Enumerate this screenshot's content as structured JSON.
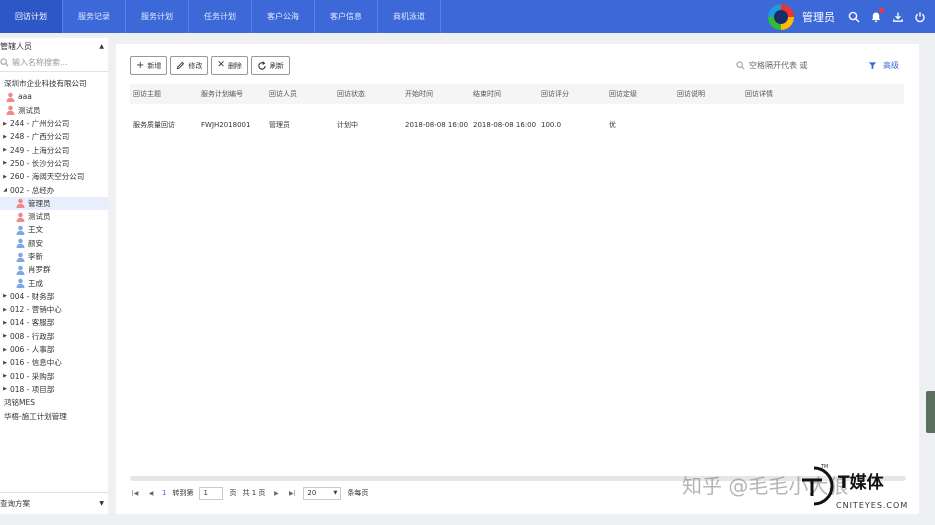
{
  "nav": {
    "tabs": [
      {
        "label": "回访计划",
        "active": true
      },
      {
        "label": "服务记录"
      },
      {
        "label": "服务计划"
      },
      {
        "label": "任务计划"
      },
      {
        "label": "客户公海"
      },
      {
        "label": "客户信息"
      },
      {
        "label": "商机泳道"
      }
    ],
    "user_name": "管理员",
    "accent": "#3d68d8"
  },
  "sidebar": {
    "title": "管辖人员",
    "search_placeholder": "输入名称搜索...",
    "tree": [
      {
        "label": "深圳市企业科技有限公司",
        "level": 0,
        "type": "org"
      },
      {
        "label": "aaa",
        "level": 1,
        "type": "user-red"
      },
      {
        "label": "测试员",
        "level": 1,
        "type": "user-red"
      },
      {
        "label": "244 - 广州分公司",
        "level": 0,
        "type": "collapsed"
      },
      {
        "label": "248 - 广西分公司",
        "level": 0,
        "type": "collapsed"
      },
      {
        "label": "249 - 上海分公司",
        "level": 0,
        "type": "collapsed"
      },
      {
        "label": "250 - 长沙分公司",
        "level": 0,
        "type": "collapsed"
      },
      {
        "label": "260 - 海阔天空分公司",
        "level": 0,
        "type": "collapsed"
      },
      {
        "label": "002 - 总经办",
        "level": 0,
        "type": "expanded"
      },
      {
        "label": "管理员",
        "level": 2,
        "type": "user-red",
        "selected": true
      },
      {
        "label": "测试员",
        "level": 2,
        "type": "user-red"
      },
      {
        "label": "王文",
        "level": 2,
        "type": "user-blue"
      },
      {
        "label": "颜安",
        "level": 2,
        "type": "user-blue"
      },
      {
        "label": "李新",
        "level": 2,
        "type": "user-blue"
      },
      {
        "label": "肖罗群",
        "level": 2,
        "type": "user-blue"
      },
      {
        "label": "王成",
        "level": 2,
        "type": "user-blue"
      },
      {
        "label": "004 - 财务部",
        "level": 0,
        "type": "collapsed"
      },
      {
        "label": "012 - 营销中心",
        "level": 0,
        "type": "collapsed"
      },
      {
        "label": "014 - 客服部",
        "level": 0,
        "type": "collapsed"
      },
      {
        "label": "008 - 行政部",
        "level": 0,
        "type": "collapsed"
      },
      {
        "label": "006 - 人事部",
        "level": 0,
        "type": "collapsed"
      },
      {
        "label": "016 - 信息中心",
        "level": 0,
        "type": "collapsed"
      },
      {
        "label": "010 - 采购部",
        "level": 0,
        "type": "collapsed"
      },
      {
        "label": "018 - 项目部",
        "level": 0,
        "type": "collapsed"
      },
      {
        "label": "鸿铭MES",
        "level": 0,
        "type": "org"
      },
      {
        "label": "华梧-施工计划管理",
        "level": 0,
        "type": "org"
      }
    ],
    "footer_label": "查询方案"
  },
  "toolbar": {
    "new_label": "新增",
    "edit_label": "修改",
    "delete_label": "删除",
    "refresh_label": "刷新",
    "search_placeholder": "空格隔开代表 或",
    "advanced_label": "高级"
  },
  "table": {
    "columns": [
      "回访主题",
      "服务计划编号",
      "回访人员",
      "回访状态",
      "开始时间",
      "结束时间",
      "回访评分",
      "回访定级",
      "回访说明",
      "回访详情"
    ],
    "rows": [
      [
        "服务质量回访",
        "FWJH2018001",
        "管理员",
        "计划中",
        "2018-08-08 16:00",
        "2018-08-08 16:00",
        "100.0",
        "优",
        "",
        ""
      ]
    ]
  },
  "pager": {
    "current_page": "1",
    "goto_label": "转到第",
    "page_unit": "页",
    "total_label": "共 1 页",
    "page_size": "20",
    "per_page_label": "条每页"
  },
  "watermark": {
    "text": "知乎 @毛毛小大狼",
    "brand": "T媒体",
    "brand_url": "CNITEYES.COM",
    "tm": "TM"
  }
}
